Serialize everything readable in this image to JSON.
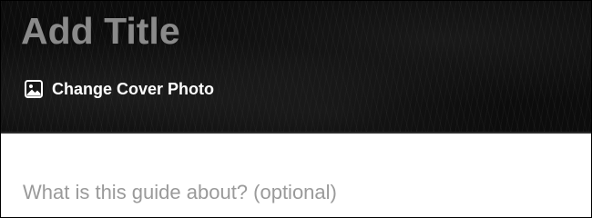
{
  "cover": {
    "title_placeholder": "Add Title",
    "change_cover_label": "Change Cover Photo",
    "change_cover_icon": "image-icon"
  },
  "body": {
    "description_placeholder": "What is this guide about? (optional)"
  },
  "colors": {
    "cover_background": "#0c0c0c",
    "title_placeholder_color": "#8a8a8a",
    "body_background": "#ffffff",
    "description_placeholder_color": "#9a9a9a"
  }
}
